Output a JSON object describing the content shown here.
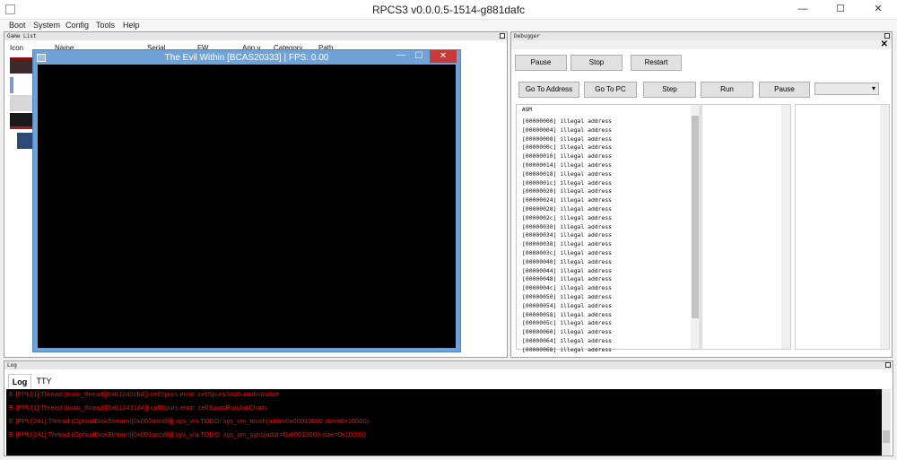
{
  "window": {
    "title": "RPCS3 v0.0.0.5-1514-g881dafc",
    "minimize_glyph": "—",
    "maximize_glyph": "☐",
    "close_glyph": "✕"
  },
  "menu": [
    "Boot",
    "System",
    "Config",
    "Tools",
    "Help"
  ],
  "game_list": {
    "title": "Game List",
    "columns": [
      "Icon",
      "Name",
      "Serial",
      "FW",
      "App v..",
      "Category",
      "Path"
    ]
  },
  "emulator": {
    "title": "The Evil Within [BCAS20333] | FPS: 0.00",
    "close_glyph": "✕",
    "minimize_glyph": "—",
    "maximize_glyph": "☐"
  },
  "debugger": {
    "title": "Debugger",
    "close_glyph": "✕",
    "row1_buttons": [
      "Pause",
      "Stop",
      "Restart"
    ],
    "row2_buttons": [
      "Go To Address",
      "Go To PC",
      "Step",
      "Run",
      "Pause"
    ],
    "select_value": "",
    "asm_header": "ASM",
    "asm_lines": [
      "[00000000] illegal address",
      "[00000004] illegal address",
      "[00000008] illegal address",
      "[0000000c] illegal address",
      "[00000010] illegal address",
      "[00000014] illegal address",
      "[00000018] illegal address",
      "[0000001c] illegal address",
      "[00000020] illegal address",
      "[00000024] illegal address",
      "[00000028] illegal address",
      "[0000002c] illegal address",
      "[00000030] illegal address",
      "[00000034] illegal address",
      "[00000038] illegal address",
      "[0000003c] illegal address",
      "[00000040] illegal address",
      "[00000044] illegal address",
      "[00000048] illegal address",
      "[0000004c] illegal address",
      "[00000050] illegal address",
      "[00000054] illegal address",
      "[00000058] illegal address",
      "[0000005c] illegal address",
      "[00000060] illegal address",
      "[00000064] illegal address",
      "[00000068] illegal address"
    ]
  },
  "log": {
    "title": "Log",
    "tabs": [
      "Log",
      "TTY"
    ],
    "lines": [
      "E {PPU[1] Thread (main_thread)[0x01242cb4]} cellSpurs error: cellSpursJobGuardInitialize",
      "E {PPU[1] Thread (main_thread)[0x01243184]} cellSpurs error: cellSpursRunJobChain",
      "E {PPU[241] Thread (OpticalDiskStream)[0x003accd8]} sys_vm TODO: sys_vm_touch(addr=0x60010000,size=0x10000)",
      "E {PPU[241] Thread (OpticalDiskStream)[0x003accd8]} sys_vm TODO: sys_vm_sync(addr=0x60010000,size=0x10000)"
    ]
  },
  "colors": {
    "log_error": "#e01010",
    "emulator_frame": "#6fa3d8",
    "emulator_close": "#c83a3a"
  }
}
